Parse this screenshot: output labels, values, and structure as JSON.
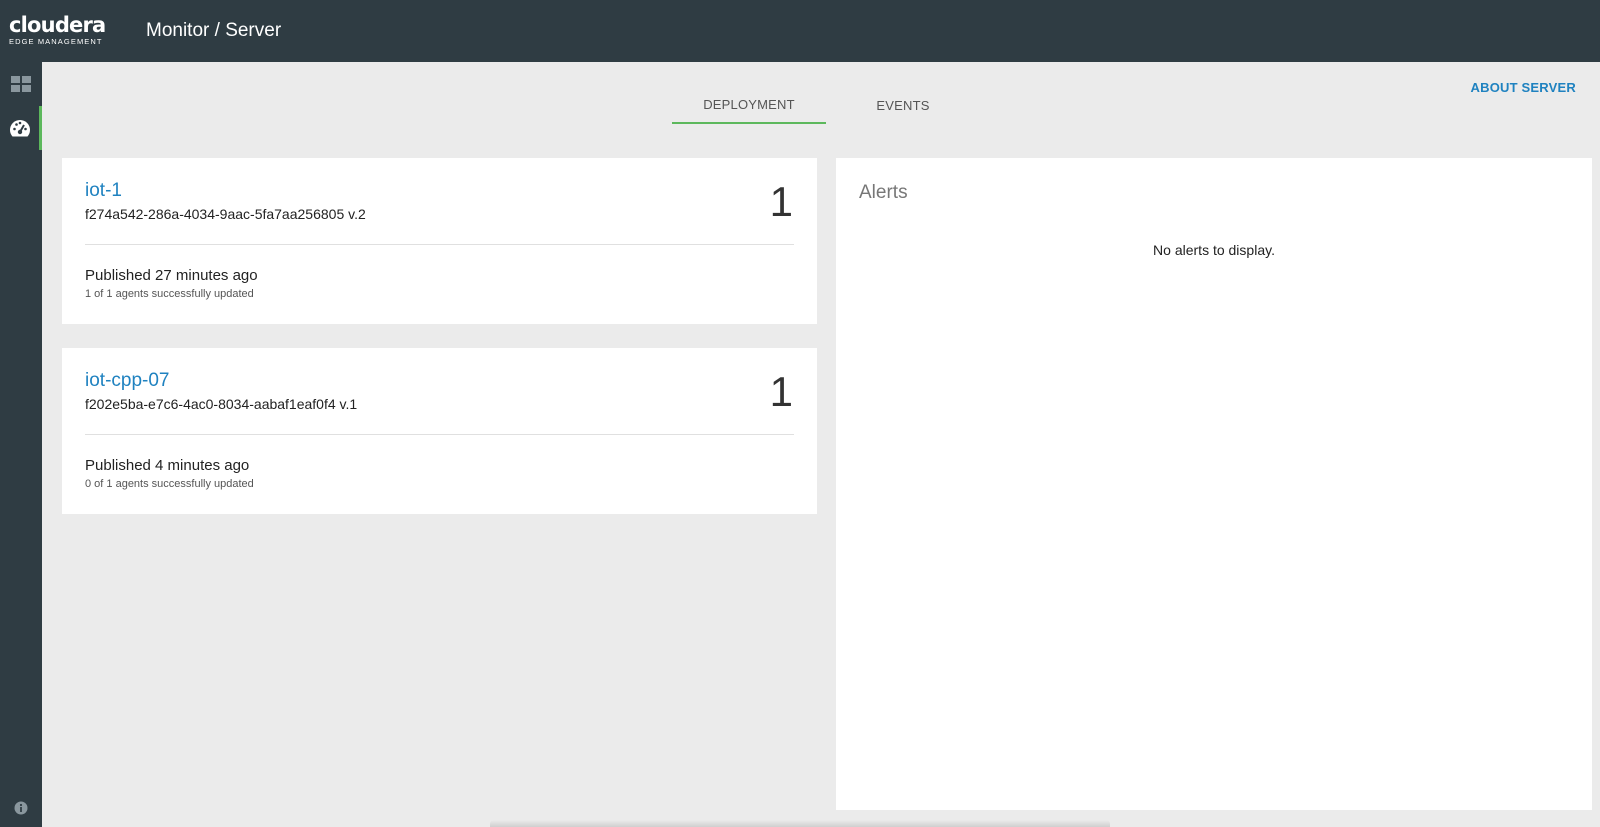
{
  "header": {
    "logo_main": "cloudera",
    "logo_sub": "EDGE MANAGEMENT",
    "title": "Monitor / Server"
  },
  "sidebar": {
    "items": [
      {
        "icon": "dashboard-grid-icon",
        "active": false
      },
      {
        "icon": "gauge-icon",
        "active": true
      }
    ],
    "footer_icon": "info-icon"
  },
  "tabs": [
    {
      "label": "DEPLOYMENT",
      "active": true
    },
    {
      "label": "EVENTS",
      "active": false
    }
  ],
  "about_label": "ABOUT SERVER",
  "deployments": [
    {
      "name": "iot-1",
      "id": "f274a542-286a-4034-9aac-5fa7aa256805 v.2",
      "count": "1",
      "published": "Published 27 minutes ago",
      "agents": "1 of 1 agents successfully updated"
    },
    {
      "name": "iot-cpp-07",
      "id": "f202e5ba-e7c6-4ac0-8034-aabaf1eaf0f4 v.1",
      "count": "1",
      "published": "Published 4 minutes ago",
      "agents": "0 of 1 agents successfully updated"
    }
  ],
  "alerts": {
    "title": "Alerts",
    "empty_message": "No alerts to display."
  },
  "colors": {
    "topbar": "#2f3c43",
    "accent_green": "#5cb85c",
    "link_blue": "#1f82c0",
    "background": "#ebebeb"
  }
}
